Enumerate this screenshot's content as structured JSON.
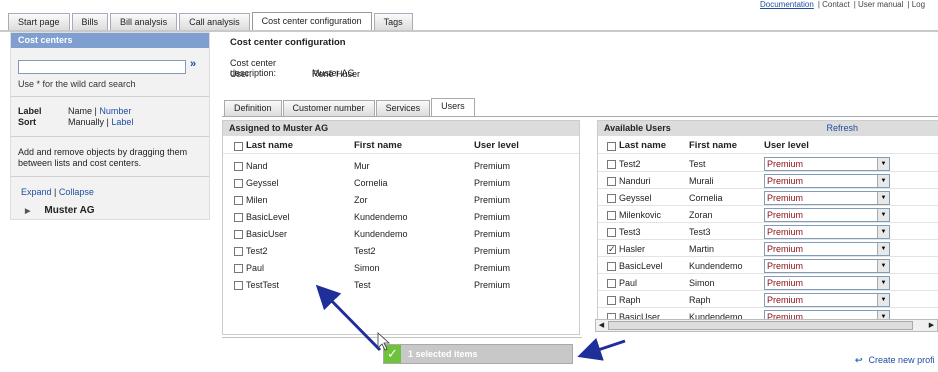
{
  "toplinks": [
    "Documentation",
    "Contact",
    "User manual",
    "Log"
  ],
  "main_tabs": [
    "Start page",
    "Bills",
    "Bill analysis",
    "Call analysis",
    "Cost center configuration",
    "Tags"
  ],
  "sidebar": {
    "title": "Cost centers",
    "search_button": "»",
    "wildcard_hint": "Use * for the wild card search",
    "label_key": "Label",
    "label_value_a": "Name",
    "label_sep": " | ",
    "label_value_b": "Number",
    "sort_key": "Sort",
    "sort_value_a": "Manually",
    "sort_value_b": "Label",
    "help_text": "Add and remove objects by dragging them between lists and cost centers.",
    "expand": "Expand",
    "collapse": "Collapse",
    "tree_item": "Muster AG"
  },
  "content": {
    "title": "Cost center configuration",
    "desc_key": "Cost center description:",
    "desc_value": "Muster AG",
    "user_key": "User:",
    "user_value": "René Huser",
    "sub_tabs": [
      "Definition",
      "Customer number",
      "Services",
      "Users"
    ]
  },
  "assigned": {
    "title": "Assigned to Muster AG",
    "headers": [
      "Last name",
      "First name",
      "User level"
    ],
    "rows": [
      [
        "Nand",
        "Mur",
        "Premium"
      ],
      [
        "Geyssel",
        "Cornelia",
        "Premium"
      ],
      [
        "Milen",
        "Zor",
        "Premium"
      ],
      [
        "BasicLevel",
        "Kundendemo",
        "Premium"
      ],
      [
        "BasicUser",
        "Kundendemo",
        "Premium"
      ],
      [
        "Test2",
        "Test2",
        "Premium"
      ],
      [
        "Paul",
        "Simon",
        "Premium"
      ],
      [
        "TestTest",
        "Test",
        "Premium"
      ]
    ]
  },
  "available": {
    "title": "Available Users",
    "refresh": "Refresh",
    "headers": [
      "Last name",
      "First name",
      "User level"
    ],
    "rows": [
      [
        "Test2",
        "Test",
        "Premium"
      ],
      [
        "Nanduri",
        "Murali",
        "Premium"
      ],
      [
        "Geyssel",
        "Cornelia",
        "Premium"
      ],
      [
        "Milenkovic",
        "Zoran",
        "Premium"
      ],
      [
        "Test3",
        "Test3",
        "Premium"
      ],
      [
        "Hasler",
        "Martin",
        "Premium"
      ],
      [
        "BasicLevel",
        "Kundendemo",
        "Premium"
      ],
      [
        "Paul",
        "Simon",
        "Premium"
      ],
      [
        "Raph",
        "Raph",
        "Premium"
      ],
      [
        "BasicUser",
        "Kundendemo",
        "Premium"
      ]
    ],
    "checked_index": 5
  },
  "drag_indicator": "1 selected items",
  "create_link": "Create new profi",
  "colors": {
    "header_blue": "#7f9fd1",
    "link": "#1f4fa0",
    "arrow": "#1f2f9a",
    "ok_green": "#6fc23b"
  }
}
